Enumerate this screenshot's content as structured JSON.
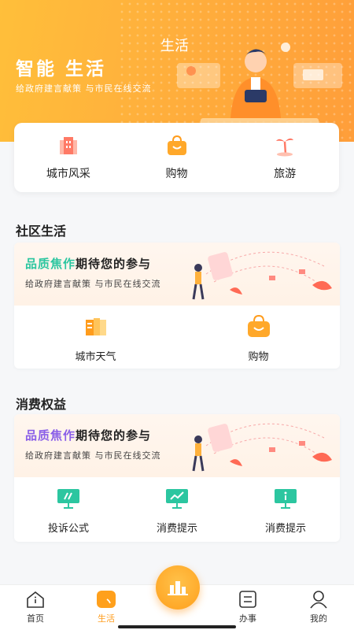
{
  "hero": {
    "title": "智能 生活",
    "subtitle": "给政府建言献策 与市民在线交流",
    "tag": "生活"
  },
  "quick_links": [
    {
      "label": "城市风采",
      "icon": "building-icon"
    },
    {
      "label": "购物",
      "icon": "shopping-bag-icon"
    },
    {
      "label": "旅游",
      "icon": "palm-tree-icon"
    }
  ],
  "community": {
    "title": "社区生活",
    "banner": {
      "highlight": "品质焦作",
      "rest": "期待您的参与",
      "subtitle": "给政府建言献策 与市民在线交流",
      "highlight_color": "#2cc6a0"
    },
    "items": [
      {
        "label": "城市天气",
        "icon": "weather-icon"
      },
      {
        "label": "购物",
        "icon": "shopping-bag-icon"
      }
    ]
  },
  "consumer": {
    "title": "消费权益",
    "banner": {
      "highlight": "品质焦作",
      "rest": "期待您的参与",
      "subtitle": "给政府建言献策 与市民在线交流",
      "highlight_color": "#8a5fe8"
    },
    "items": [
      {
        "label": "投诉公式",
        "icon": "complaint-monitor-icon"
      },
      {
        "label": "消费提示",
        "icon": "trend-monitor-icon"
      },
      {
        "label": "消费提示",
        "icon": "info-monitor-icon"
      }
    ]
  },
  "tabbar": [
    {
      "label": "首页",
      "icon": "home-icon",
      "active": false
    },
    {
      "label": "生活",
      "icon": "life-icon",
      "active": true
    },
    {
      "label": "办事",
      "icon": "list-icon",
      "active": false
    },
    {
      "label": "我的",
      "icon": "user-icon",
      "active": false
    }
  ],
  "colors": {
    "accent": "#ff9c1c",
    "hero": "#ffb13c"
  }
}
